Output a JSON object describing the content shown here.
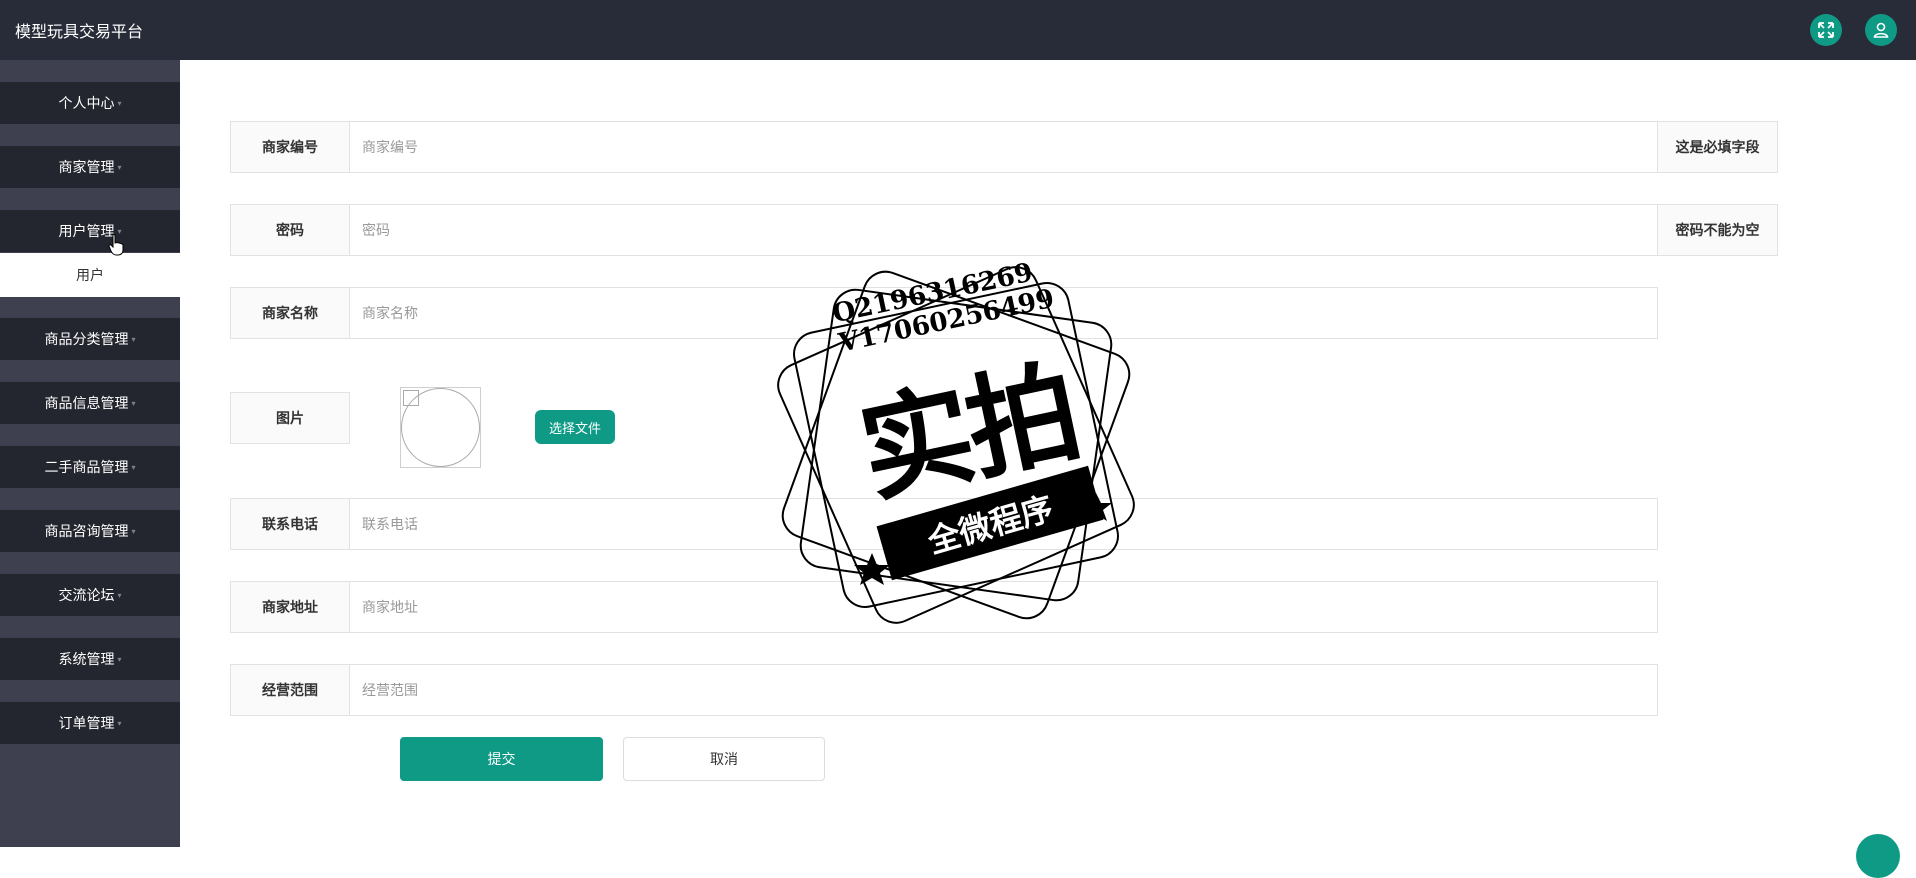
{
  "app": {
    "title": "模型玩具交易平台"
  },
  "header": {
    "fullscreen_icon": "fullscreen-icon",
    "user_icon": "user-icon"
  },
  "sidebar": {
    "items": [
      {
        "label": "个人中心"
      },
      {
        "label": "商家管理"
      },
      {
        "label": "用户管理"
      },
      {
        "label": "商品分类管理"
      },
      {
        "label": "商品信息管理"
      },
      {
        "label": "二手商品管理"
      },
      {
        "label": "商品咨询管理"
      },
      {
        "label": "交流论坛"
      },
      {
        "label": "系统管理"
      },
      {
        "label": "订单管理"
      }
    ],
    "submenu": {
      "label": "用户"
    }
  },
  "form": {
    "merchant_id": {
      "label": "商家编号",
      "placeholder": "商家编号",
      "hint": "这是必填字段"
    },
    "password": {
      "label": "密码",
      "placeholder": "密码",
      "hint": "密码不能为空"
    },
    "merchant_name": {
      "label": "商家名称",
      "placeholder": "商家名称"
    },
    "image": {
      "label": "图片",
      "button": "选择文件"
    },
    "phone": {
      "label": "联系电话",
      "placeholder": "联系电话"
    },
    "address": {
      "label": "商家地址",
      "placeholder": "商家地址"
    },
    "scope": {
      "label": "经营范围",
      "placeholder": "经营范围"
    },
    "submit": "提交",
    "cancel": "取消"
  },
  "watermark": {
    "line1": "Q2196316269",
    "line2": "V17060256499",
    "big": "实拍",
    "band": "全微程序"
  },
  "colors": {
    "accent": "#0f9a86",
    "header_bg": "#272c38",
    "sidebar_bg": "#3e4050",
    "nav_item_bg": "#23262f"
  }
}
